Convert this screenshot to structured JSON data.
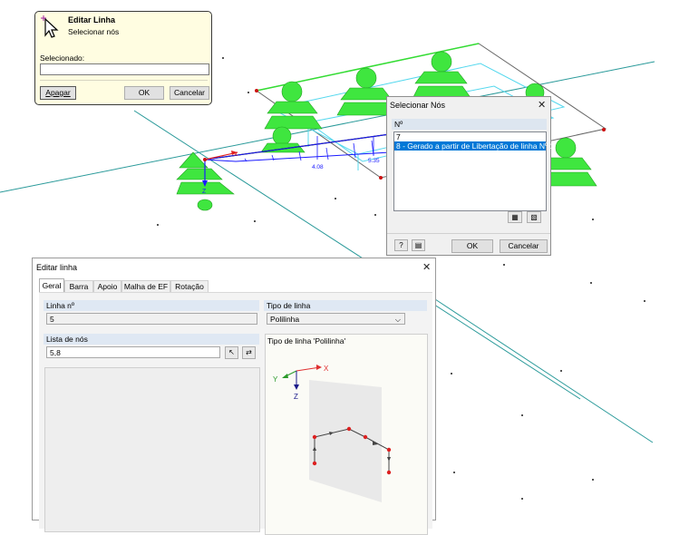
{
  "pick_dialog": {
    "title": "Editar Linha",
    "subtitle": "Selecionar nós",
    "selected_label": "Selecionado:",
    "selected_value": "",
    "delete_button": "Apagar",
    "ok_button": "OK",
    "cancel_button": "Cancelar"
  },
  "select_nodes_dialog": {
    "title": "Selecionar Nós",
    "column_header": "Nº",
    "items": [
      "7",
      "8 - Gerado a partir de Libertação de linha Nº 1"
    ],
    "selected_index": 1,
    "ok_button": "OK",
    "cancel_button": "Cancelar"
  },
  "edit_line_dialog": {
    "title": "Editar linha",
    "tabs": [
      "Geral",
      "Barra",
      "Apoio",
      "Malha de EF",
      "Rotação"
    ],
    "active_tab": "Geral",
    "line_no_label": "Linha nº",
    "line_no_value": "5",
    "line_type_label": "Tipo de linha",
    "line_type_value": "Polilinha",
    "node_list_label": "Lista de nós",
    "node_list_value": "5,8",
    "preview_label": "Tipo de linha 'Polilinha'",
    "axis_x": "X",
    "axis_y": "Y",
    "axis_z": "Z"
  },
  "viewport": {
    "axis_x": "X",
    "axis_z": "Z",
    "dim_1": "4.08",
    "dim_2": "5.35",
    "support_color": "#38e838",
    "member_color": "#1a1aff"
  }
}
